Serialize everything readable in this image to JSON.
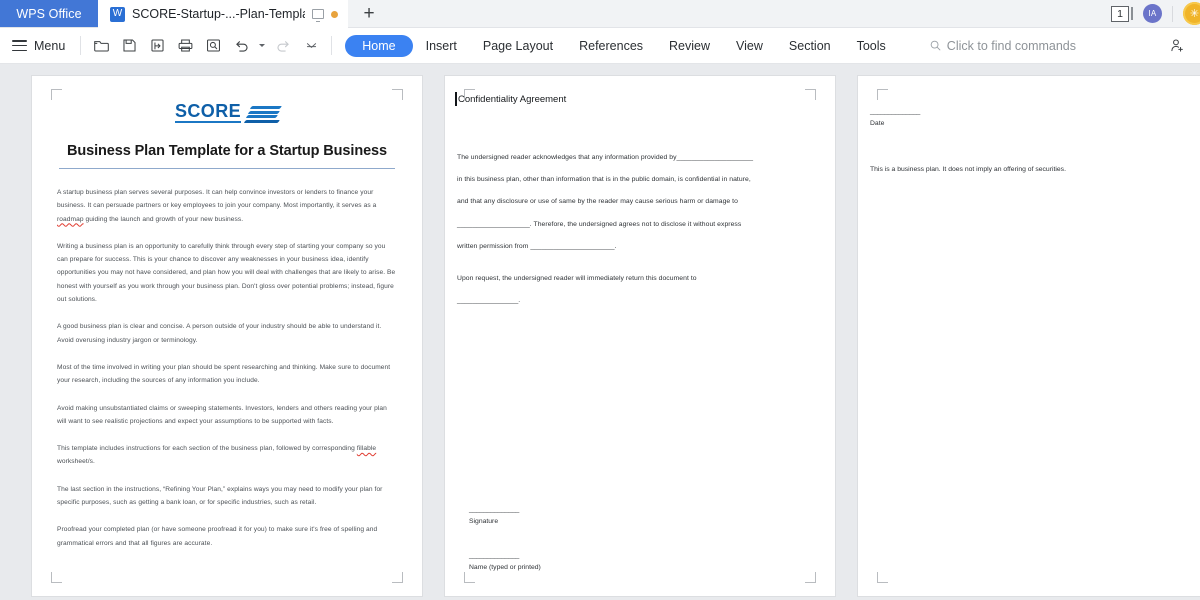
{
  "titlebar": {
    "app_name": "WPS Office",
    "tab_title": "SCORE-Startup-...-Plan-Template",
    "tab_icon": "wps-writer-icon",
    "monitor_icon": "monitor-icon",
    "modified_dot": "unsaved-dot",
    "new_tab_label": "+",
    "page_count": "1",
    "avatar_initials": "IA",
    "coin_icon": "coin-icon",
    "coin_glyph": "✳"
  },
  "ribbon": {
    "menu_label": "Menu",
    "quick_access": [
      {
        "name": "open-file-icon",
        "title": "Open"
      },
      {
        "name": "save-icon",
        "title": "Save"
      },
      {
        "name": "save-as-icon",
        "title": "Save As"
      },
      {
        "name": "print-icon",
        "title": "Print"
      },
      {
        "name": "print-preview-icon",
        "title": "Print Preview"
      },
      {
        "name": "undo-icon",
        "title": "Undo"
      },
      {
        "name": "redo-icon",
        "title": "Redo"
      },
      {
        "name": "customize-quick-access-icon",
        "title": "Customize"
      }
    ],
    "tabs": [
      {
        "label": "Home",
        "active": true
      },
      {
        "label": "Insert",
        "active": false
      },
      {
        "label": "Page Layout",
        "active": false
      },
      {
        "label": "References",
        "active": false
      },
      {
        "label": "Review",
        "active": false
      },
      {
        "label": "View",
        "active": false
      },
      {
        "label": "Section",
        "active": false
      },
      {
        "label": "Tools",
        "active": false
      }
    ],
    "find_placeholder": "Click to find commands",
    "share_icon": "share-user-icon"
  },
  "document": {
    "page1": {
      "logo_text": "SCORE",
      "title": "Business Plan Template for a Startup Business",
      "paragraphs": [
        {
          "pre": "A startup business plan serves several purposes. It can help convince investors or lenders to finance your business. It can persuade partners or key employees to join your company.  Most importantly, it serves as a ",
          "misspelled": "roadmap",
          "post": " guiding the launch and growth  of your new business."
        },
        {
          "pre": "Writing a business plan is an opportunity to carefully think through every step of starting your  company so you can prepare for  success. This is your  chance to discover any weaknesses in your business idea, identify opportunities you may not have considered, and plan how you will deal with challenges that are likely to arise. Be honest with yourself as you work through  your business plan. Don't gloss over potential problems; instead, figure  out solutions.",
          "misspelled": "",
          "post": ""
        },
        {
          "pre": "A good  business plan is clear and concise. A person  outside of your industry should be able to understand it. Avoid overusing industry jargon or terminology.",
          "misspelled": "",
          "post": ""
        },
        {
          "pre": "Most of the time  involved in writing your  plan should be  spent researching  and thinking. Make  sure  to document your research, including  the sources of any information you include.",
          "misspelled": "",
          "post": ""
        },
        {
          "pre": "Avoid making unsubstantiated claims or sweeping statements. Investors,  lenders and others reading your plan will want  to see realistic projections and expect your  assumptions to be supported  with  facts.",
          "misspelled": "",
          "post": ""
        },
        {
          "pre": "This template includes instructions for each section of the  business plan,  followed by corresponding ",
          "misspelled": "fillable",
          "post": " worksheet/s."
        },
        {
          "pre": "The last section in the instructions, “Refining Your Plan,” explains ways you may need to modify your plan for specific purposes, such as getting a bank loan, or for specific industries, such as retail.",
          "misspelled": "",
          "post": ""
        },
        {
          "pre": "Proofread your completed plan (or have someone proofread it for you)  to make  sure  it's free of spelling and grammatical errors and that all figures are accurate.",
          "misspelled": "",
          "post": ""
        }
      ]
    },
    "page2": {
      "heading": "Confidentiality Agreement",
      "lines": [
        "The undersigned reader acknowledges that any information provided by____________________",
        "in this business plan, other than information that is in the public domain, is confidential in nature,",
        "and that any disclosure or use of same  by the reader may cause serious harm or damage to",
        "___________________. Therefore, the undersigned agrees not to disclose it without express",
        "written permission from ______________________."
      ],
      "line_after": "Upon request, the undersigned reader will immediately return this document to",
      "line_after2": "________________.",
      "signature_rule": "______________",
      "signature_label": "Signature",
      "name_rule": "______________",
      "name_label": "Name (typed or printed)"
    },
    "page3": {
      "date_rule": "______________",
      "date_label": "Date",
      "disclaimer": "This is a business plan. It does not imply an offering of securities."
    }
  },
  "colors": {
    "brand_blue": "#4277d6",
    "active_tab_blue": "#3b82f2",
    "score_blue": "#0e5fa8",
    "spell_error_red": "#e03a2f",
    "canvas_gray": "#e8eaed",
    "coin_yellow": "#f0b429"
  }
}
